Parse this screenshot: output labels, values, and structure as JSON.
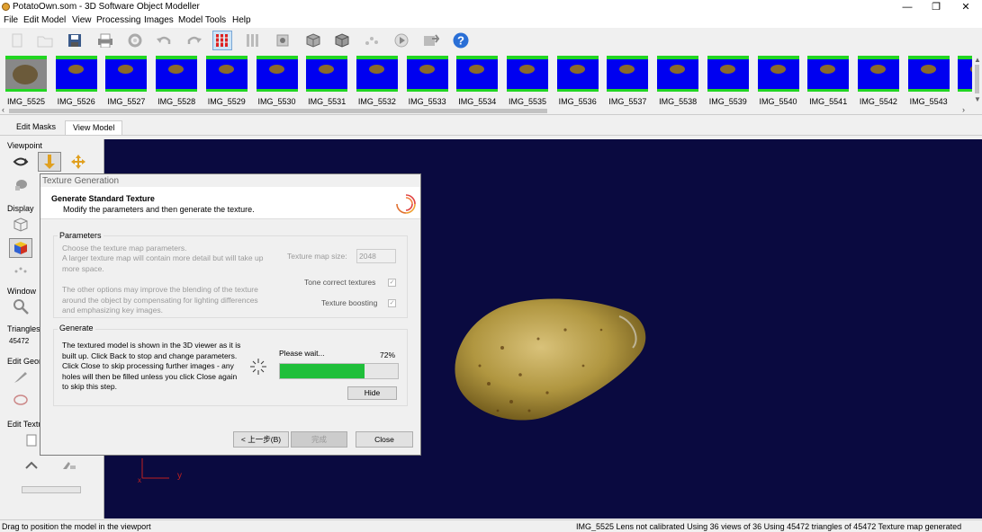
{
  "window": {
    "title": "PotatoOwn.som - 3D Software Object Modeller",
    "min": "—",
    "max": "❐",
    "close": "✕"
  },
  "menu": [
    "File",
    "Edit Model",
    "View",
    "Processing",
    "Images",
    "Model Tools",
    "Help"
  ],
  "toolbar": {
    "icons": [
      "new-icon",
      "open-icon",
      "save-icon",
      "print-icon",
      "settings-icon",
      "undo-icon",
      "redo-icon",
      "grid-icon",
      "columns-icon",
      "mask-icon",
      "cube-icon",
      "cube-texture-icon",
      "points-icon",
      "play-icon",
      "export-icon",
      "help-icon"
    ]
  },
  "thumbnails": [
    "IMG_5525",
    "IMG_5526",
    "IMG_5527",
    "IMG_5528",
    "IMG_5529",
    "IMG_5530",
    "IMG_5531",
    "IMG_5532",
    "IMG_5533",
    "IMG_5534",
    "IMG_5535",
    "IMG_5536",
    "IMG_5537",
    "IMG_5538",
    "IMG_5539",
    "IMG_5540",
    "IMG_5541",
    "IMG_5542",
    "IMG_5543",
    "IMG_"
  ],
  "tabs": {
    "edit_masks": "Edit Masks",
    "view_model": "View Model"
  },
  "left_panel": {
    "viewpoint": "Viewpoint",
    "display": "Display",
    "window": "Window",
    "triangles": "Triangles",
    "triangles_value": "45472",
    "edit_geom": "Edit Geom",
    "edit_texture": "Edit Textu"
  },
  "dialog": {
    "title": "Texture Generation",
    "heading": "Generate Standard Texture",
    "subheading": "Modify the parameters and then generate the texture.",
    "params_label": "Parameters",
    "params_text1": "Choose the texture map parameters.",
    "params_text2": "A larger texture map will contain more detail but will take up more space.",
    "params_text3": "The other options may improve the blending of the texture around the object by compensating for lighting differences and emphasizing key images.",
    "texture_size_label": "Texture map size:",
    "texture_size_value": "2048",
    "tone_correct": "Tone correct textures",
    "texture_boosting": "Texture boosting",
    "generate_label": "Generate",
    "generate_text": "The textured model is shown in the 3D viewer as it is built up. Click Back to stop and change parameters. Click Close to skip processing further images - any holes will then be filled unless you click Close again to skip this step.",
    "please_wait": "Please wait...",
    "progress_pct": "72%",
    "progress_value": 0.72,
    "hide": "Hide",
    "back": "< 上一步(B)",
    "finish": "完成",
    "close": "Close"
  },
  "axes": {
    "x": "x",
    "y": "y"
  },
  "status": {
    "left": "Drag to position the model in the viewport",
    "right": "IMG_5525  Lens not calibrated  Using 36 views of 36  Using 45472 triangles of 45472  Texture map generated"
  },
  "colors": {
    "viewport_bg": "#0a0a40",
    "thumb_bg": "#0000f0",
    "thumb_border": "#22d622",
    "progress": "#1fbf3a"
  }
}
